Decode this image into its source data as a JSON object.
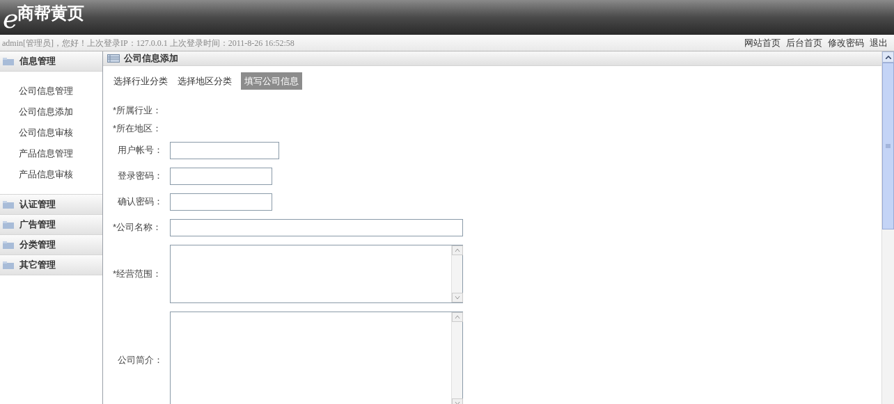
{
  "logo": {
    "mark": "e",
    "text": "商帮黄页"
  },
  "user_bar": {
    "text": "admin[管理员]，您好！上次登录IP：127.0.0.1 上次登录时间：2011-8-26 16:52:58",
    "links": [
      "网站首页",
      "后台首页",
      "修改密码",
      "退出"
    ]
  },
  "sidebar": {
    "groups": [
      {
        "title": "信息管理",
        "items": [
          "公司信息管理",
          "公司信息添加",
          "公司信息审核",
          "产品信息管理",
          "产品信息审核"
        ]
      },
      {
        "title": "认证管理"
      },
      {
        "title": "广告管理"
      },
      {
        "title": "分类管理"
      },
      {
        "title": "其它管理"
      }
    ]
  },
  "panel": {
    "title": "公司信息添加",
    "steps": [
      {
        "label": "选择行业分类",
        "selected": false
      },
      {
        "label": "选择地区分类",
        "selected": false
      },
      {
        "label": "填写公司信息",
        "selected": true
      }
    ],
    "fields": [
      {
        "label": "*所属行业：",
        "kind": "text"
      },
      {
        "label": "*所在地区：",
        "kind": "text"
      },
      {
        "label": "用户帐号：",
        "kind": "input"
      },
      {
        "label": "登录密码：",
        "kind": "input"
      },
      {
        "label": "确认密码：",
        "kind": "input"
      },
      {
        "label": "*公司名称：",
        "kind": "input"
      },
      {
        "label": "*经营范围：",
        "kind": "textarea"
      },
      {
        "label": "公司简介：",
        "kind": "textarea"
      }
    ]
  }
}
